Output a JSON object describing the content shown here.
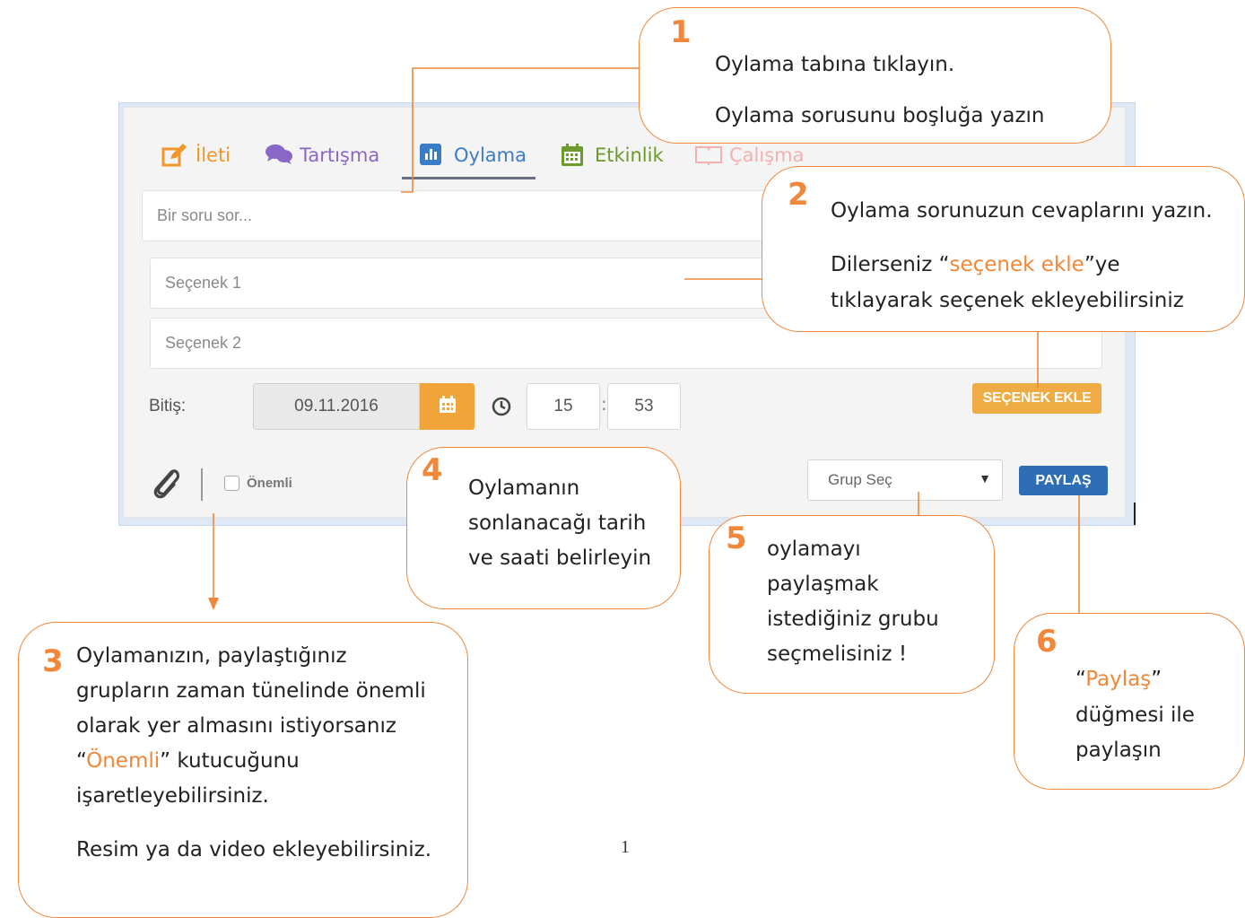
{
  "composer": {
    "tabs": [
      {
        "label": "İleti"
      },
      {
        "label": "Tartışma"
      },
      {
        "label": "Oylama"
      },
      {
        "label": "Etkinlik"
      },
      {
        "label": "Çalışma"
      }
    ],
    "question_placeholder": "Bir soru sor...",
    "options": [
      "Seçenek 1",
      "Seçenek 2"
    ],
    "end_label": "Bitiş:",
    "end_date": "09.11.2016",
    "end_hour": "15",
    "end_minute": "53",
    "time_separator": ":",
    "add_option_label": "SEÇENEK EKLE",
    "important_label": "Önemli",
    "important_checked": false,
    "group_select_value": "Grup Seç",
    "share_label": "PAYLAŞ"
  },
  "callouts": {
    "c1": {
      "number": "1",
      "line1": "Oylama tabına tıklayın.",
      "line2": "Oylama sorusunu boşluğa yazın"
    },
    "c2": {
      "number": "2",
      "line1": "Oylama sorunuzun cevaplarını yazın.",
      "line2_pre": "Dilerseniz “",
      "line2_hl": "seçenek ekle",
      "line2_post": "”ye",
      "line3": "tıklayarak seçenek ekleyebilirsiniz"
    },
    "c3": {
      "number": "3",
      "line1": "Oylamanızın, paylaştığınız",
      "line2": "grupların zaman tünelinde önemli",
      "line3": "olarak yer almasını istiyorsanız",
      "line4_pre": "“",
      "line4_hl": "Önemli",
      "line4_post": "” kutucuğunu",
      "line5": "işaretleyebilirsiniz.",
      "line6": "Resim ya da video ekleyebilirsiniz."
    },
    "c4": {
      "number": "4",
      "line1": "Oylamanın",
      "line2": "sonlanacağı tarih",
      "line3": "ve saati belirleyin"
    },
    "c5": {
      "number": "5",
      "line1": "oylamayı",
      "line2": "paylaşmak",
      "line3": "istediğiniz grubu",
      "line4": "seçmelisiniz !"
    },
    "c6": {
      "number": "6",
      "line1_pre": "“",
      "line1_hl": "Paylaş",
      "line1_post": "”",
      "line2": "düğmesi ile",
      "line3": "paylaşın"
    }
  },
  "page_number": "1",
  "colors": {
    "accent": "#f0873a",
    "share": "#2d6eb4",
    "add_option": "#f0ac44",
    "active_tab": "#3a7cc6"
  }
}
